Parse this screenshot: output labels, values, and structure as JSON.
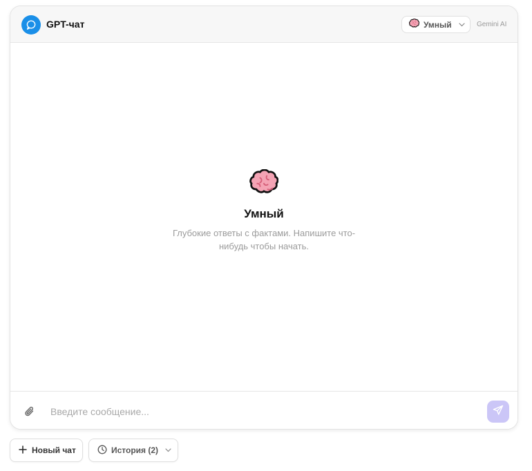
{
  "header": {
    "title": "GPT-чат",
    "mode_selected": "Умный",
    "provider": "Gemini AI"
  },
  "empty_state": {
    "title": "Умный",
    "description": "Глубокие ответы с фактами. Напишите что-нибудь чтобы начать."
  },
  "composer": {
    "placeholder": "Введите сообщение..."
  },
  "footer": {
    "new_chat_label": "Новый чат",
    "history_label": "История (2)"
  },
  "colors": {
    "accent": "#1a8fe8",
    "send_button": "#cbc6f7"
  },
  "icons": {
    "logo": "chat-bubble-icon",
    "mode": "brain-icon",
    "attach": "paperclip-icon",
    "send": "send-icon",
    "new_chat": "plus-icon",
    "history": "clock-icon",
    "dropdown": "chevron-down-icon"
  }
}
